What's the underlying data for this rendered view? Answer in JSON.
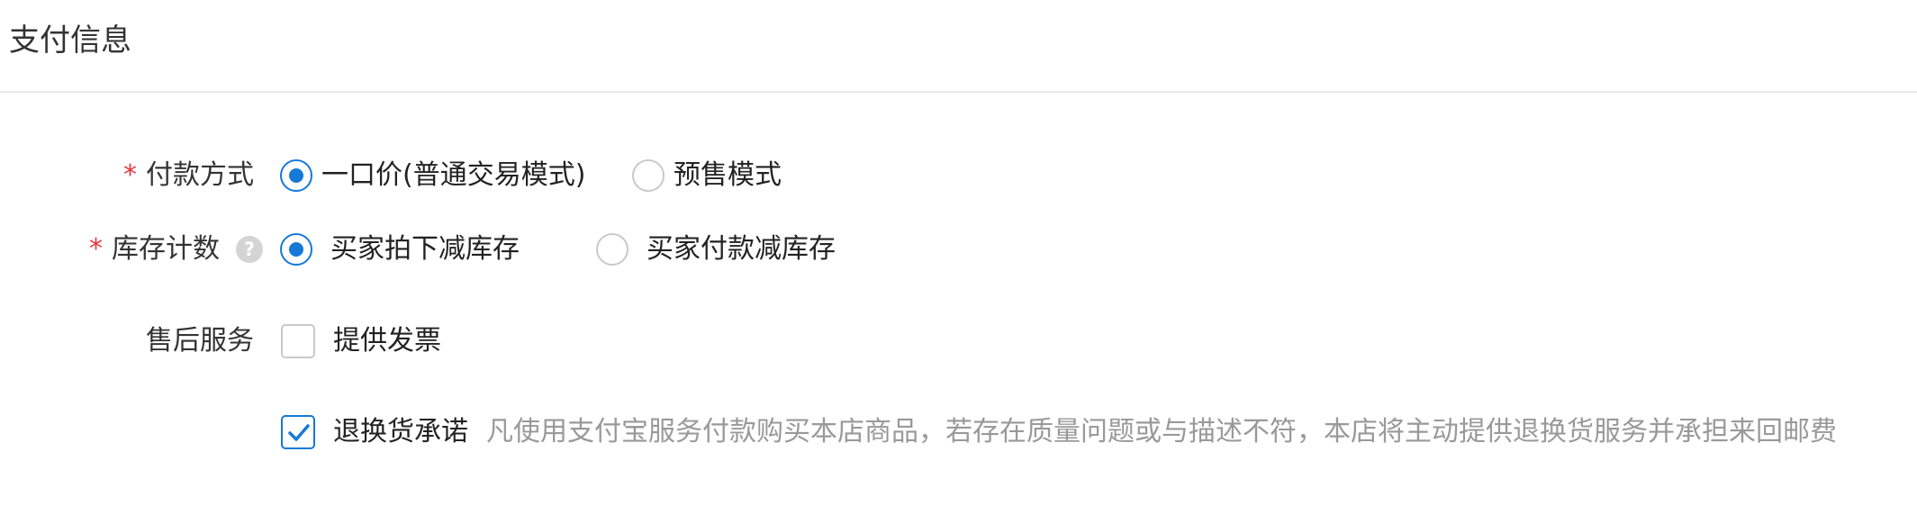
{
  "section": {
    "title": "支付信息"
  },
  "payment": {
    "label": "付款方式",
    "required_mark": "*",
    "options": [
      {
        "label": "一口价(普通交易模式)",
        "selected": true
      },
      {
        "label": "预售模式",
        "selected": false
      }
    ]
  },
  "inventory": {
    "label": "库存计数",
    "required_mark": "*",
    "help_glyph": "?",
    "options": [
      {
        "label": "买家拍下减库存",
        "selected": true
      },
      {
        "label": "买家付款减库存",
        "selected": false
      }
    ]
  },
  "after_sales": {
    "label": "售后服务",
    "options": [
      {
        "label": "提供发票",
        "checked": false
      },
      {
        "label": "退换货承诺",
        "checked": true,
        "description": "凡使用支付宝服务付款购买本店商品，若存在质量问题或与描述不符，本店将主动提供退换货服务并承担来回邮费"
      }
    ]
  },
  "colors": {
    "accent": "#1479d7",
    "required": "#e4393c",
    "muted": "#999999"
  }
}
